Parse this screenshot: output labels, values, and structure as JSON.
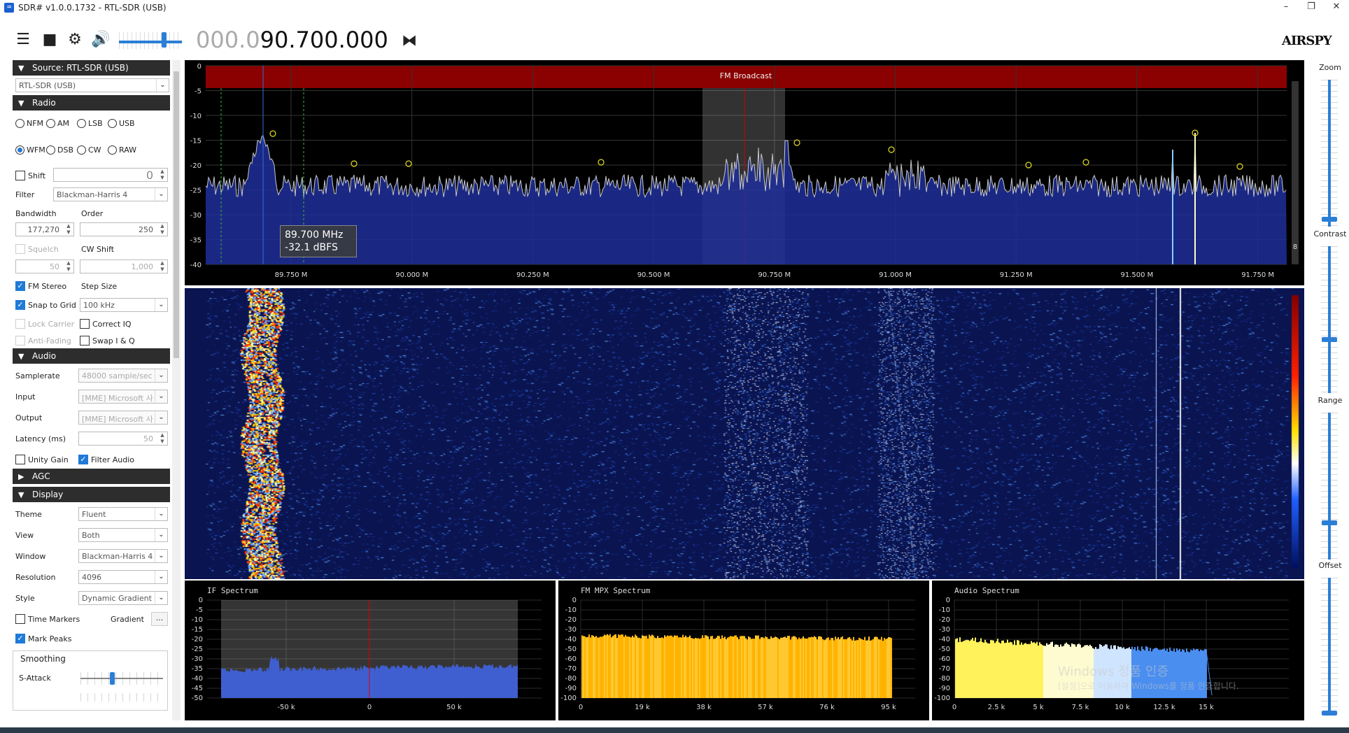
{
  "window": {
    "title": "SDR# v1.0.0.1732 - RTL-SDR (USB)",
    "controls": [
      "–",
      "❐",
      "✕"
    ]
  },
  "toolbar": {
    "frequency_dim": "000.0",
    "frequency_main": "90.700.000",
    "logo": "AIRSPY"
  },
  "source": {
    "header": "Source: RTL-SDR (USB)",
    "device": "RTL-SDR (USB)"
  },
  "radio": {
    "header": "Radio",
    "modes_row1": [
      "NFM",
      "AM",
      "LSB",
      "USB"
    ],
    "modes_row2": [
      "WFM",
      "DSB",
      "CW",
      "RAW"
    ],
    "selected_mode": "WFM",
    "shift_label": "Shift",
    "shift_value": "0",
    "filter_label": "Filter",
    "filter_value": "Blackman-Harris 4",
    "bandwidth_label": "Bandwidth",
    "bandwidth_value": "177,270",
    "order_label": "Order",
    "order_value": "250",
    "squelch_label": "Squelch",
    "squelch_value": "50",
    "cwshift_label": "CW Shift",
    "cwshift_value": "1,000",
    "fmstereo_label": "FM Stereo",
    "stepsize_label": "Step Size",
    "snap_label": "Snap to Grid",
    "step_value": "100 kHz",
    "lockcarrier_label": "Lock Carrier",
    "correctiq_label": "Correct IQ",
    "antifading_label": "Anti-Fading",
    "swapiq_label": "Swap I & Q"
  },
  "audio": {
    "header": "Audio",
    "samplerate_label": "Samplerate",
    "samplerate_value": "48000 sample/sec",
    "input_label": "Input",
    "input_value": "[MME] Microsoft 사",
    "output_label": "Output",
    "output_value": "[MME] Microsoft 사",
    "latency_label": "Latency (ms)",
    "latency_value": "50",
    "unitygain_label": "Unity Gain",
    "filteraudio_label": "Filter Audio"
  },
  "agc": {
    "header": "AGC"
  },
  "display": {
    "header": "Display",
    "theme_label": "Theme",
    "theme_value": "Fluent",
    "view_label": "View",
    "view_value": "Both",
    "window_label": "Window",
    "window_value": "Blackman-Harris 4",
    "resolution_label": "Resolution",
    "resolution_value": "4096",
    "style_label": "Style",
    "style_value": "Dynamic Gradient",
    "timemarkers_label": "Time Markers",
    "gradient_label": "Gradient",
    "gradient_btn": "...",
    "markpeaks_label": "Mark Peaks",
    "smoothing_label": "Smoothing",
    "sattack_label": "S-Attack"
  },
  "spectrum": {
    "band_label": "FM Broadcast",
    "y_ticks": [
      "0",
      "-5",
      "-10",
      "-15",
      "-20",
      "-25",
      "-30",
      "-35",
      "-40"
    ],
    "x_ticks": [
      "89.750 M",
      "90.000 M",
      "90.250 M",
      "90.500 M",
      "90.750 M",
      "91.000 M",
      "91.250 M",
      "91.500 M",
      "91.750 M"
    ],
    "tooltip_freq": "89.700 MHz",
    "tooltip_level": "-32.1 dBFS",
    "scale_value": "8"
  },
  "if_spectrum": {
    "title": "IF Spectrum",
    "y_ticks": [
      "0",
      "-5",
      "-10",
      "-15",
      "-20",
      "-25",
      "-30",
      "-35",
      "-40",
      "-45",
      "-50"
    ],
    "x_ticks": [
      "-50 k",
      "0",
      "50 k"
    ]
  },
  "mpx_spectrum": {
    "title": "FM MPX Spectrum",
    "y_ticks": [
      "0",
      "-10",
      "-20",
      "-30",
      "-40",
      "-50",
      "-60",
      "-70",
      "-80",
      "-90",
      "-100"
    ],
    "x_ticks": [
      "0",
      "19 k",
      "38 k",
      "57 k",
      "76 k",
      "95 k"
    ]
  },
  "audio_spectrum": {
    "title": "Audio Spectrum",
    "y_ticks": [
      "0",
      "-10",
      "-20",
      "-30",
      "-40",
      "-50",
      "-60",
      "-70",
      "-80",
      "-90",
      "-100"
    ],
    "x_ticks": [
      "0",
      "2.5 k",
      "5 k",
      "7.5 k",
      "10 k",
      "12.5 k",
      "15 k"
    ]
  },
  "right_sliders": {
    "zoom": "Zoom",
    "contrast": "Contrast",
    "range": "Range",
    "offset": "Offset"
  },
  "watermark": {
    "line1": "Windows 정품 인증",
    "line2": "[설정]으로 이동하여 Windows를 정품 인증합니다."
  },
  "colors": {
    "accent": "#1f7ad8",
    "band": "#8b0000",
    "header_bg": "#2d2d2d"
  }
}
